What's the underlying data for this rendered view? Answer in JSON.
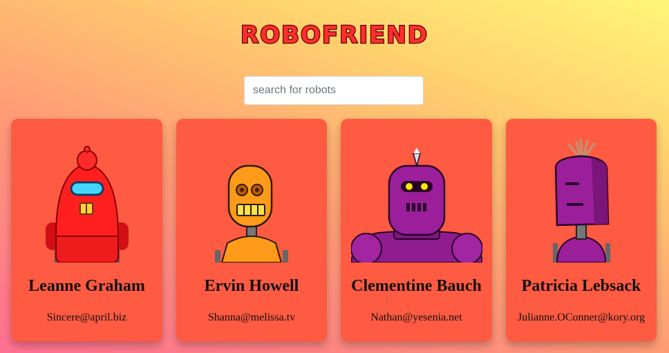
{
  "header": {
    "title": "ROBOFRIEND"
  },
  "search": {
    "placeholder": "search for robots",
    "value": ""
  },
  "robots": [
    {
      "name": "Leanne Graham",
      "email": "Sincere@april.biz"
    },
    {
      "name": "Ervin Howell",
      "email": "Shanna@melissa.tv"
    },
    {
      "name": "Clementine Bauch",
      "email": "Nathan@yesenia.net"
    },
    {
      "name": "Patricia Lebsack",
      "email": "Julianne.OConner@kory.org"
    }
  ],
  "colors": {
    "card": "#ff5a42",
    "title_fill": "#ff2e2e",
    "title_stroke": "#7a0000"
  }
}
